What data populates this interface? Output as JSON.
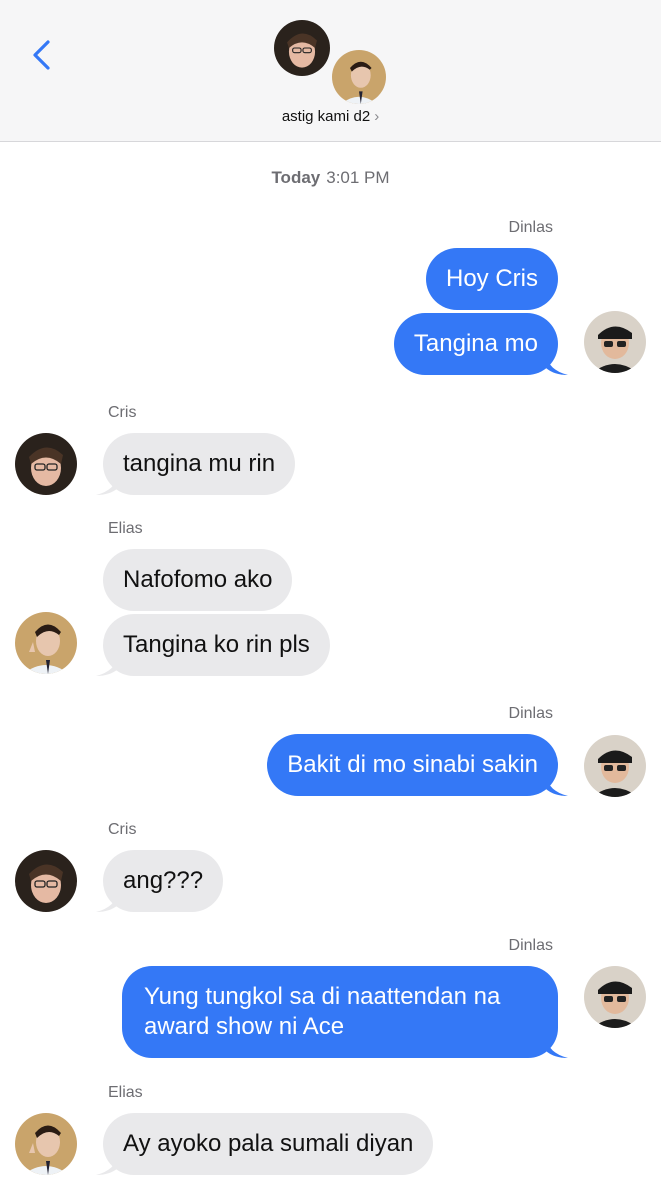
{
  "header": {
    "group_name": "astig kami d2",
    "chevron": "›",
    "back_icon": "chevron-left-icon"
  },
  "timestamp": {
    "day": "Today",
    "time": "3:01 PM"
  },
  "colors": {
    "outgoing": "#3478f6",
    "incoming": "#e9e9eb",
    "accent": "#3478f6"
  },
  "messages": [
    {
      "sender": "Dinlas",
      "text": "Hoy Cris",
      "direction": "outgoing"
    },
    {
      "sender": "Dinlas",
      "text": "Tangina mo",
      "direction": "outgoing"
    },
    {
      "sender": "Cris",
      "text": "tangina mu rin",
      "direction": "incoming"
    },
    {
      "sender": "Elias",
      "text": "Nafofomo ako",
      "direction": "incoming"
    },
    {
      "sender": "Elias",
      "text": "Tangina ko rin pls",
      "direction": "incoming"
    },
    {
      "sender": "Dinlas",
      "text": "Bakit di mo sinabi sakin",
      "direction": "outgoing"
    },
    {
      "sender": "Cris",
      "text": "ang???",
      "direction": "incoming"
    },
    {
      "sender": "Dinlas",
      "text": "Yung tungkol sa di naattendan na award show ni Ace",
      "direction": "outgoing"
    },
    {
      "sender": "Elias",
      "text": "Ay ayoko pala sumali diyan",
      "direction": "incoming"
    }
  ],
  "sender_labels": {
    "dinlas": "Dinlas",
    "cris": "Cris",
    "elias": "Elias"
  }
}
